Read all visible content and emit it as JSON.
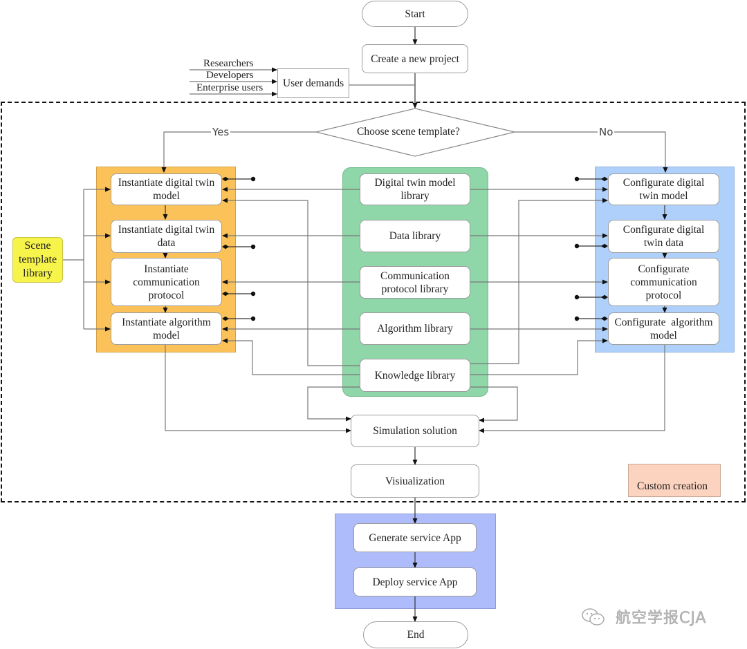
{
  "flow": {
    "start": "Start",
    "create_project": "Create a new project",
    "decision": "Choose scene template?",
    "yes_label": "Yes",
    "no_label": "No",
    "simulation": "Simulation solution",
    "visualization": "Visiualization",
    "end": "End"
  },
  "user_demands": {
    "title": "User demands",
    "inputs": [
      "Researchers",
      "Developers",
      "Enterprise users"
    ]
  },
  "scene_template_library": "Scene template library",
  "instantiate_group": {
    "color": "#fbc25a",
    "items": [
      "Instantiate digital twin model",
      "Instantiate digital twin data",
      "Instantiate communication protocol",
      "Instantiate algorithm model"
    ]
  },
  "library_group": {
    "color": "#8fd6a8",
    "items": [
      "Digital twin model library",
      "Data library",
      "Communication protocol library",
      "Algorithm library",
      "Knowledge library"
    ]
  },
  "configurate_group": {
    "color": "#aed0fb",
    "items": [
      "Configurate digital twin model",
      "Configurate digital twin data",
      "Configurate communication protocol",
      "Configurate  algorithm model"
    ]
  },
  "service_group": {
    "color": "#aebcfb",
    "items": [
      "Generate service App",
      "Deploy service App"
    ]
  },
  "legend": {
    "custom_creation": "Custom creation",
    "color": "#fbd3bf"
  },
  "watermark": "航空学报CJA"
}
